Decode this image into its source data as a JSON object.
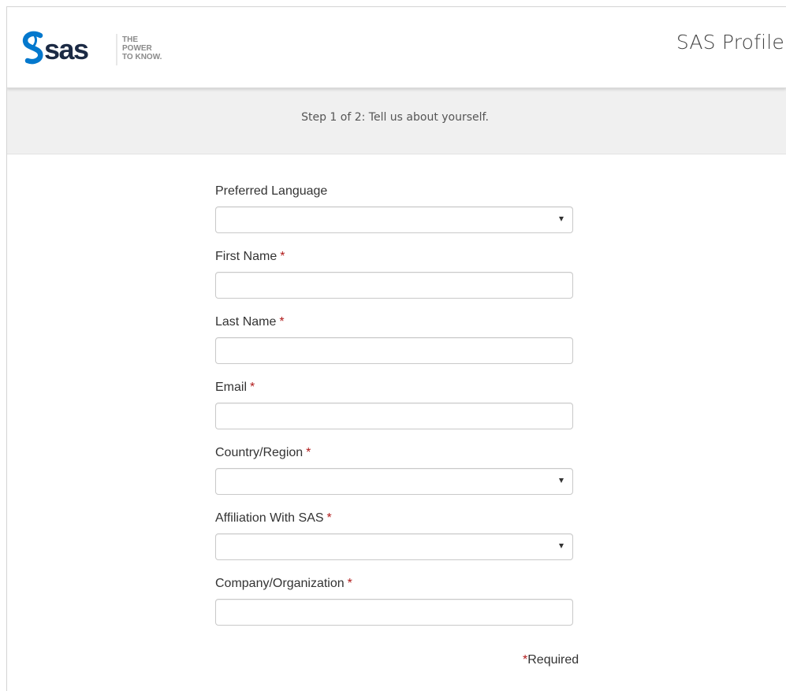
{
  "header": {
    "brand": {
      "logo_text": "sas",
      "tagline": [
        "THE",
        "POWER",
        "TO KNOW."
      ],
      "colors": {
        "brand_blue": "#0378cd",
        "wordmark": "#1b2a44",
        "tagline": "#8a8a8a"
      }
    },
    "title": "SAS Profile"
  },
  "step": {
    "text": "Step 1 of 2: Tell us about yourself."
  },
  "form": {
    "required_marker": "*",
    "fields": [
      {
        "label": "Preferred Language",
        "type": "select",
        "required": false,
        "value": ""
      },
      {
        "label": "First Name",
        "type": "text",
        "required": true,
        "value": ""
      },
      {
        "label": "Last Name",
        "type": "text",
        "required": true,
        "value": ""
      },
      {
        "label": "Email",
        "type": "text",
        "required": true,
        "value": ""
      },
      {
        "label": "Country/Region",
        "type": "select",
        "required": true,
        "value": ""
      },
      {
        "label": "Affiliation With SAS",
        "type": "select",
        "required": true,
        "value": ""
      },
      {
        "label": "Company/Organization",
        "type": "text",
        "required": true,
        "value": ""
      }
    ]
  },
  "footer_note": {
    "star": "*",
    "text": "Required"
  },
  "colors": {
    "required_star": "#b01a1a",
    "step_bar_bg": "#f0f0f0",
    "input_border": "#c9c9c9"
  },
  "icons": {
    "select_caret": "caret-down-icon"
  }
}
